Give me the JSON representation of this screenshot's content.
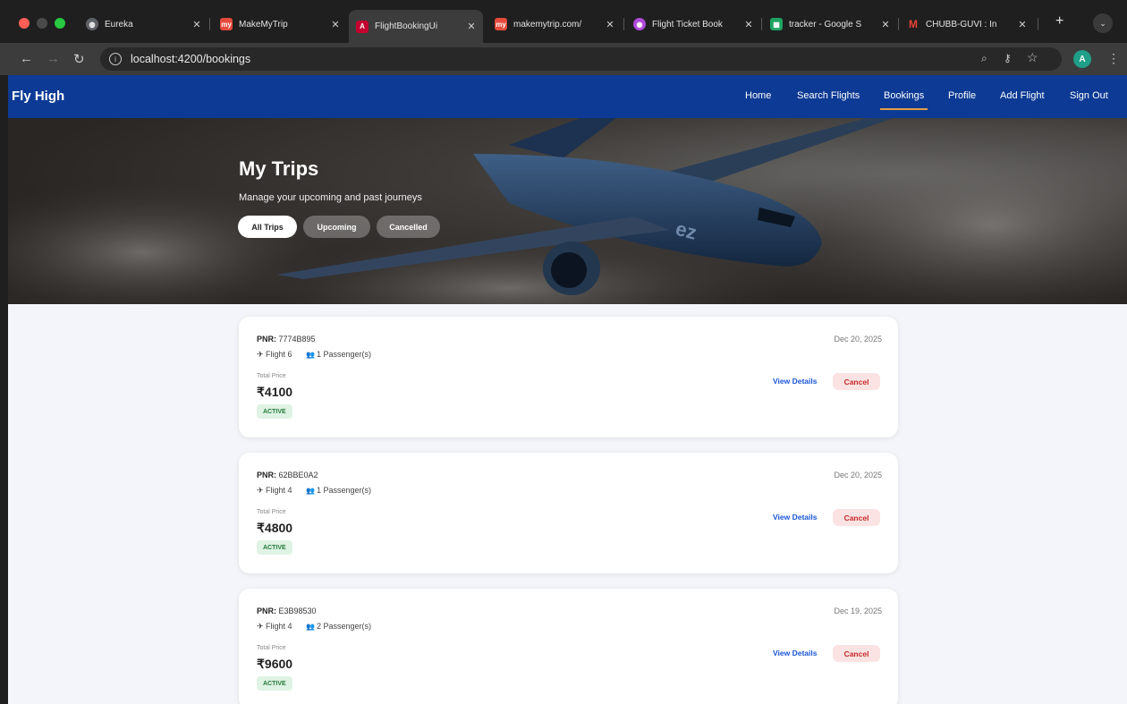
{
  "browser": {
    "tabs": [
      {
        "title": "Eureka",
        "favicon": "globe-icon",
        "color": "#9aa0a6"
      },
      {
        "title": "MakeMyTrip",
        "favicon": "mmt-icon",
        "color": "#e64a3b"
      },
      {
        "title": "FlightBookingUi",
        "favicon": "angular-icon",
        "color": "#c3002f"
      },
      {
        "title": "makemytrip.com/",
        "favicon": "mmt-icon",
        "color": "#e64a3b"
      },
      {
        "title": "Flight Ticket Book",
        "favicon": "ticket-icon",
        "color": "#b04ad9"
      },
      {
        "title": "tracker - Google S",
        "favicon": "sheets-icon",
        "color": "#1ea362"
      },
      {
        "title": "CHUBB-GUVI : In",
        "favicon": "gmail-icon",
        "color": "#ea4335"
      }
    ],
    "url": "localhost:4200/bookings",
    "profile_initial": "A"
  },
  "nav": {
    "brand": "Fly High",
    "links": [
      "Home",
      "Search Flights",
      "Bookings",
      "Profile",
      "Add Flight",
      "Sign Out"
    ],
    "active": "Bookings"
  },
  "hero": {
    "title": "My Trips",
    "subtitle": "Manage your upcoming and past journeys",
    "filters": [
      "All Trips",
      "Upcoming",
      "Cancelled"
    ]
  },
  "bookings": [
    {
      "pnr_label": "PNR:",
      "pnr": "7774B895",
      "date": "Dec 20, 2025",
      "flight": "Flight 6",
      "passengers": "1 Passenger(s)",
      "total_label": "Total Price",
      "price": "₹4100",
      "status": "ACTIVE",
      "view": "View Details",
      "cancel": "Cancel"
    },
    {
      "pnr_label": "PNR:",
      "pnr": "62BBE0A2",
      "date": "Dec 20, 2025",
      "flight": "Flight 4",
      "passengers": "1 Passenger(s)",
      "total_label": "Total Price",
      "price": "₹4800",
      "status": "ACTIVE",
      "view": "View Details",
      "cancel": "Cancel"
    },
    {
      "pnr_label": "PNR:",
      "pnr": "E3B98530",
      "date": "Dec 19, 2025",
      "flight": "Flight 4",
      "passengers": "2 Passenger(s)",
      "total_label": "Total Price",
      "price": "₹9600",
      "status": "ACTIVE",
      "view": "View Details",
      "cancel": "Cancel"
    }
  ]
}
